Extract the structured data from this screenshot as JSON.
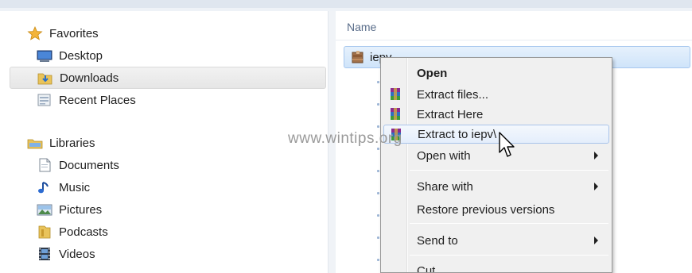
{
  "nav": {
    "favorites": "Favorites",
    "desktop": "Desktop",
    "downloads": "Downloads",
    "recent_places": "Recent Places",
    "libraries": "Libraries",
    "documents": "Documents",
    "music": "Music",
    "pictures": "Pictures",
    "podcasts": "Podcasts",
    "videos": "Videos"
  },
  "content": {
    "column_name": "Name",
    "file_name": "iepv"
  },
  "watermark": "www.wintips.org",
  "context_menu": {
    "open": "Open",
    "extract_files": "Extract files...",
    "extract_here": "Extract Here",
    "extract_to": "Extract to iepv\\",
    "open_with": "Open with",
    "share_with": "Share with",
    "restore_previous_versions": "Restore previous versions",
    "send_to": "Send to",
    "cut": "Cut"
  },
  "icons": {
    "favorites": "star-icon",
    "desktop": "desktop-icon",
    "downloads": "downloads-folder-icon",
    "recent_places": "recent-places-icon",
    "libraries": "libraries-icon",
    "documents": "document-icon",
    "music": "music-note-icon",
    "pictures": "pictures-icon",
    "podcasts": "podcast-folder-icon",
    "videos": "film-icon",
    "archive": "winrar-archive-icon"
  },
  "colors": {
    "selection_blue": "#cfe4fa",
    "menu_bg": "#f0f0f0",
    "header_text": "#5a6d8a"
  }
}
